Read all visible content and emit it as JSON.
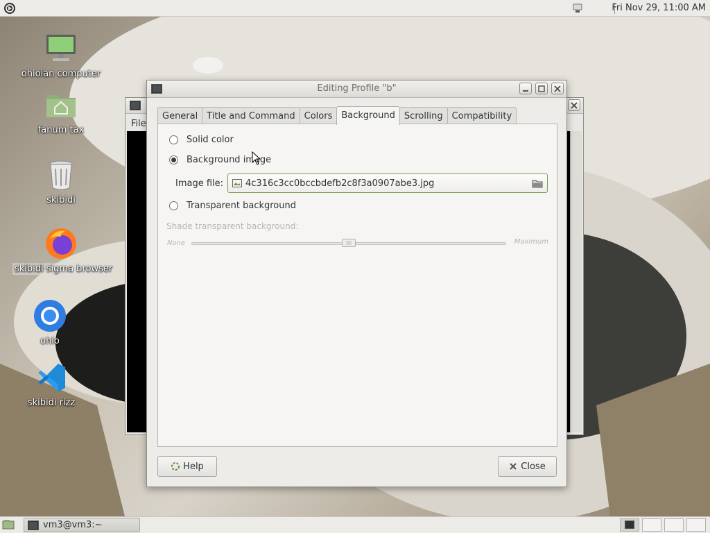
{
  "top_panel": {
    "clock": "Fri Nov 29, 11:00 AM"
  },
  "desktop_icons": [
    {
      "label": "ohioian computer",
      "icon": "computer-icon"
    },
    {
      "label": "fanum tax",
      "icon": "home-folder-icon"
    },
    {
      "label": "skibidi",
      "icon": "trash-icon"
    },
    {
      "label": "skibidi sigma browser",
      "icon": "firefox-icon"
    },
    {
      "label": "ohio",
      "icon": "chromium-icon"
    },
    {
      "label": "skibidi rizz",
      "icon": "vscode-icon"
    }
  ],
  "background_terminal": {
    "menu_label": "File"
  },
  "dialog": {
    "title": "Editing Profile \"b\"",
    "tabs": [
      {
        "label": "General"
      },
      {
        "label": "Title and Command"
      },
      {
        "label": "Colors"
      },
      {
        "label": "Background"
      },
      {
        "label": "Scrolling"
      },
      {
        "label": "Compatibility"
      }
    ],
    "active_tab": "Background",
    "options": {
      "solid_color": "Solid color",
      "background_image": "Background image",
      "transparent": "Transparent background"
    },
    "selected_option": "Background image",
    "image_file_label": "Image file:",
    "image_file_value": "4c316c3cc0bccbdefb2c8f3a0907abe3.jpg",
    "shade_label": "Shade transparent background:",
    "slider_min_label": "None",
    "slider_max_label": "Maximum",
    "shade_level": 0.5,
    "help_label": "Help",
    "close_label": "Close"
  },
  "taskbar": {
    "task_label": "vm3@vm3:~"
  },
  "colors": {
    "accent_border": "#7b9a4b",
    "terminal_bg": "#000000"
  }
}
